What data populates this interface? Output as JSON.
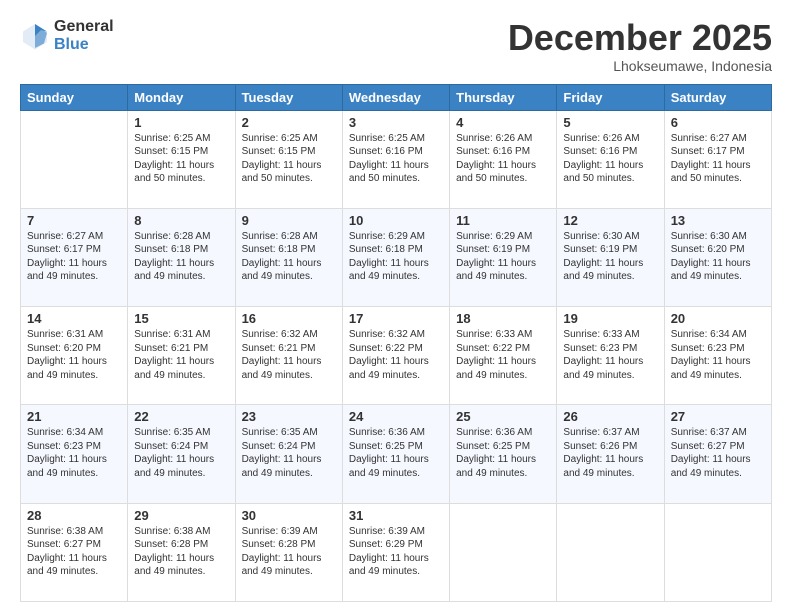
{
  "logo": {
    "general": "General",
    "blue": "Blue"
  },
  "header": {
    "month": "December 2025",
    "location": "Lhokseumawe, Indonesia"
  },
  "weekdays": [
    "Sunday",
    "Monday",
    "Tuesday",
    "Wednesday",
    "Thursday",
    "Friday",
    "Saturday"
  ],
  "weeks": [
    [
      {
        "day": "",
        "sunrise": "",
        "sunset": "",
        "daylight": ""
      },
      {
        "day": "1",
        "sunrise": "Sunrise: 6:25 AM",
        "sunset": "Sunset: 6:15 PM",
        "daylight": "Daylight: 11 hours and 50 minutes."
      },
      {
        "day": "2",
        "sunrise": "Sunrise: 6:25 AM",
        "sunset": "Sunset: 6:15 PM",
        "daylight": "Daylight: 11 hours and 50 minutes."
      },
      {
        "day": "3",
        "sunrise": "Sunrise: 6:25 AM",
        "sunset": "Sunset: 6:16 PM",
        "daylight": "Daylight: 11 hours and 50 minutes."
      },
      {
        "day": "4",
        "sunrise": "Sunrise: 6:26 AM",
        "sunset": "Sunset: 6:16 PM",
        "daylight": "Daylight: 11 hours and 50 minutes."
      },
      {
        "day": "5",
        "sunrise": "Sunrise: 6:26 AM",
        "sunset": "Sunset: 6:16 PM",
        "daylight": "Daylight: 11 hours and 50 minutes."
      },
      {
        "day": "6",
        "sunrise": "Sunrise: 6:27 AM",
        "sunset": "Sunset: 6:17 PM",
        "daylight": "Daylight: 11 hours and 50 minutes."
      }
    ],
    [
      {
        "day": "7",
        "sunrise": "Sunrise: 6:27 AM",
        "sunset": "Sunset: 6:17 PM",
        "daylight": "Daylight: 11 hours and 49 minutes."
      },
      {
        "day": "8",
        "sunrise": "Sunrise: 6:28 AM",
        "sunset": "Sunset: 6:18 PM",
        "daylight": "Daylight: 11 hours and 49 minutes."
      },
      {
        "day": "9",
        "sunrise": "Sunrise: 6:28 AM",
        "sunset": "Sunset: 6:18 PM",
        "daylight": "Daylight: 11 hours and 49 minutes."
      },
      {
        "day": "10",
        "sunrise": "Sunrise: 6:29 AM",
        "sunset": "Sunset: 6:18 PM",
        "daylight": "Daylight: 11 hours and 49 minutes."
      },
      {
        "day": "11",
        "sunrise": "Sunrise: 6:29 AM",
        "sunset": "Sunset: 6:19 PM",
        "daylight": "Daylight: 11 hours and 49 minutes."
      },
      {
        "day": "12",
        "sunrise": "Sunrise: 6:30 AM",
        "sunset": "Sunset: 6:19 PM",
        "daylight": "Daylight: 11 hours and 49 minutes."
      },
      {
        "day": "13",
        "sunrise": "Sunrise: 6:30 AM",
        "sunset": "Sunset: 6:20 PM",
        "daylight": "Daylight: 11 hours and 49 minutes."
      }
    ],
    [
      {
        "day": "14",
        "sunrise": "Sunrise: 6:31 AM",
        "sunset": "Sunset: 6:20 PM",
        "daylight": "Daylight: 11 hours and 49 minutes."
      },
      {
        "day": "15",
        "sunrise": "Sunrise: 6:31 AM",
        "sunset": "Sunset: 6:21 PM",
        "daylight": "Daylight: 11 hours and 49 minutes."
      },
      {
        "day": "16",
        "sunrise": "Sunrise: 6:32 AM",
        "sunset": "Sunset: 6:21 PM",
        "daylight": "Daylight: 11 hours and 49 minutes."
      },
      {
        "day": "17",
        "sunrise": "Sunrise: 6:32 AM",
        "sunset": "Sunset: 6:22 PM",
        "daylight": "Daylight: 11 hours and 49 minutes."
      },
      {
        "day": "18",
        "sunrise": "Sunrise: 6:33 AM",
        "sunset": "Sunset: 6:22 PM",
        "daylight": "Daylight: 11 hours and 49 minutes."
      },
      {
        "day": "19",
        "sunrise": "Sunrise: 6:33 AM",
        "sunset": "Sunset: 6:23 PM",
        "daylight": "Daylight: 11 hours and 49 minutes."
      },
      {
        "day": "20",
        "sunrise": "Sunrise: 6:34 AM",
        "sunset": "Sunset: 6:23 PM",
        "daylight": "Daylight: 11 hours and 49 minutes."
      }
    ],
    [
      {
        "day": "21",
        "sunrise": "Sunrise: 6:34 AM",
        "sunset": "Sunset: 6:23 PM",
        "daylight": "Daylight: 11 hours and 49 minutes."
      },
      {
        "day": "22",
        "sunrise": "Sunrise: 6:35 AM",
        "sunset": "Sunset: 6:24 PM",
        "daylight": "Daylight: 11 hours and 49 minutes."
      },
      {
        "day": "23",
        "sunrise": "Sunrise: 6:35 AM",
        "sunset": "Sunset: 6:24 PM",
        "daylight": "Daylight: 11 hours and 49 minutes."
      },
      {
        "day": "24",
        "sunrise": "Sunrise: 6:36 AM",
        "sunset": "Sunset: 6:25 PM",
        "daylight": "Daylight: 11 hours and 49 minutes."
      },
      {
        "day": "25",
        "sunrise": "Sunrise: 6:36 AM",
        "sunset": "Sunset: 6:25 PM",
        "daylight": "Daylight: 11 hours and 49 minutes."
      },
      {
        "day": "26",
        "sunrise": "Sunrise: 6:37 AM",
        "sunset": "Sunset: 6:26 PM",
        "daylight": "Daylight: 11 hours and 49 minutes."
      },
      {
        "day": "27",
        "sunrise": "Sunrise: 6:37 AM",
        "sunset": "Sunset: 6:27 PM",
        "daylight": "Daylight: 11 hours and 49 minutes."
      }
    ],
    [
      {
        "day": "28",
        "sunrise": "Sunrise: 6:38 AM",
        "sunset": "Sunset: 6:27 PM",
        "daylight": "Daylight: 11 hours and 49 minutes."
      },
      {
        "day": "29",
        "sunrise": "Sunrise: 6:38 AM",
        "sunset": "Sunset: 6:28 PM",
        "daylight": "Daylight: 11 hours and 49 minutes."
      },
      {
        "day": "30",
        "sunrise": "Sunrise: 6:39 AM",
        "sunset": "Sunset: 6:28 PM",
        "daylight": "Daylight: 11 hours and 49 minutes."
      },
      {
        "day": "31",
        "sunrise": "Sunrise: 6:39 AM",
        "sunset": "Sunset: 6:29 PM",
        "daylight": "Daylight: 11 hours and 49 minutes."
      },
      {
        "day": "",
        "sunrise": "",
        "sunset": "",
        "daylight": ""
      },
      {
        "day": "",
        "sunrise": "",
        "sunset": "",
        "daylight": ""
      },
      {
        "day": "",
        "sunrise": "",
        "sunset": "",
        "daylight": ""
      }
    ]
  ]
}
